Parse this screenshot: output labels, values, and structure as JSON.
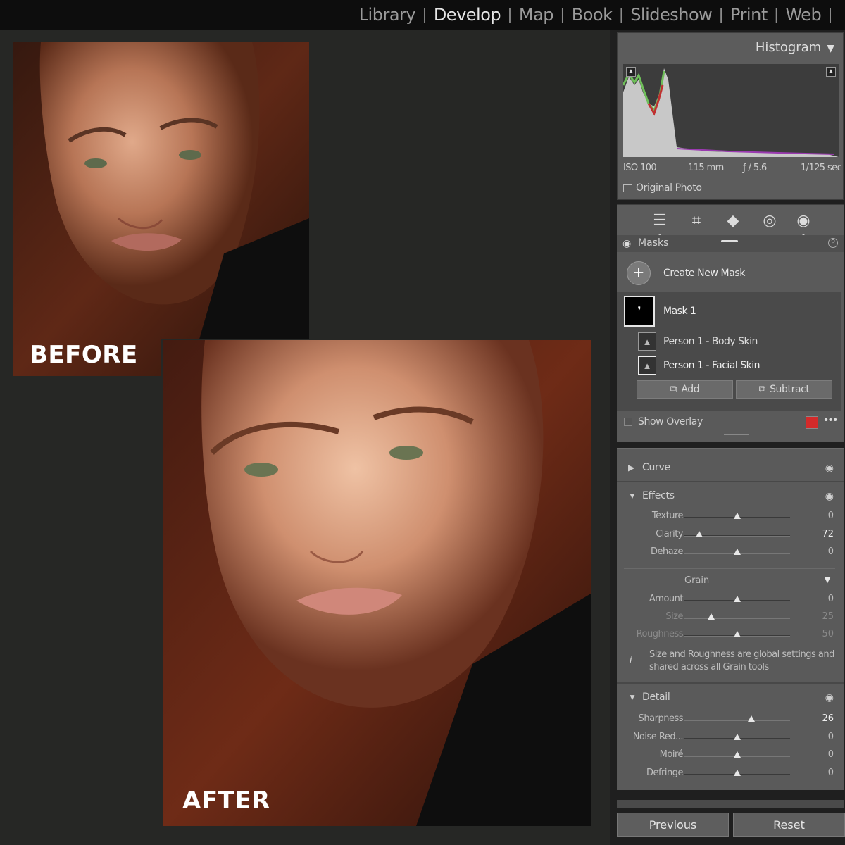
{
  "modules": {
    "library": "Library",
    "develop": "Develop",
    "map": "Map",
    "book": "Book",
    "slideshow": "Slideshow",
    "print": "Print",
    "web": "Web",
    "active": "Develop"
  },
  "photos": {
    "before_label": "BEFORE",
    "after_label": "AFTER"
  },
  "histogram": {
    "title": "Histogram",
    "iso": "ISO 100",
    "focal": "115 mm",
    "aperture": "ƒ / 5.6",
    "shutter": "1/125 sec",
    "original_photo": "Original Photo"
  },
  "tools": {
    "edit_icon": "sliders-icon",
    "crop_icon": "crop-icon",
    "heal_icon": "eraser-icon",
    "redeye_icon": "redeye-icon",
    "mask_icon": "mask-icon"
  },
  "masks": {
    "title": "Masks",
    "create_new": "Create New Mask",
    "mask1": "Mask 1",
    "sub1": "Person 1 - Body Skin",
    "sub2": "Person 1 - Facial Skin",
    "add": "Add",
    "subtract": "Subtract",
    "show_overlay": "Show Overlay",
    "overlay_color": "#d32a2a"
  },
  "adjust": {
    "curve": "Curve",
    "effects": "Effects",
    "texture": {
      "label": "Texture",
      "value": "0",
      "level": 0
    },
    "clarity": {
      "label": "Clarity",
      "value": "– 72",
      "level": -72
    },
    "dehaze": {
      "label": "Dehaze",
      "value": "0",
      "level": 0
    },
    "grain": "Grain",
    "amount": {
      "label": "Amount",
      "value": "0",
      "level": 0
    },
    "size": {
      "label": "Size",
      "value": "25",
      "level": 25
    },
    "roughness": {
      "label": "Roughness",
      "value": "50",
      "level": 50
    },
    "grain_info": "Size and Roughness are global settings and shared across all Grain tools",
    "detail": "Detail",
    "sharpness": {
      "label": "Sharpness",
      "value": "26",
      "level": 26
    },
    "noise": {
      "label": "Noise Red...",
      "value": "0",
      "level": 0
    },
    "moire": {
      "label": "Moiré",
      "value": "0",
      "level": 0
    },
    "defringe": {
      "label": "Defringe",
      "value": "0",
      "level": 0
    }
  },
  "footer": {
    "previous": "Previous",
    "reset": "Reset"
  }
}
